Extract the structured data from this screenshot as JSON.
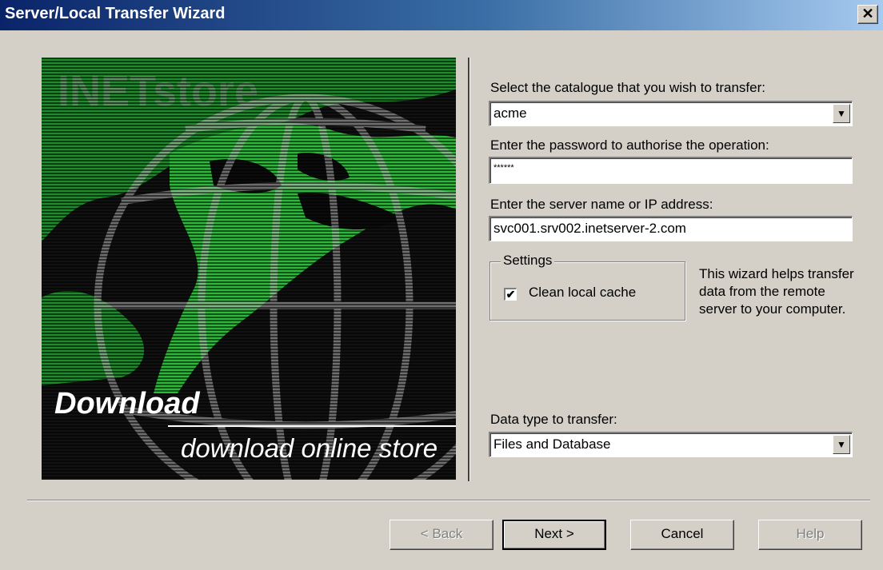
{
  "window": {
    "title": "Server/Local Transfer Wizard",
    "close_label": "✕"
  },
  "banner": {
    "title": "Download",
    "subtitle": "download online store",
    "logo_text": "INETstore"
  },
  "catalogue": {
    "label": "Select the catalogue that you wish to transfer:",
    "value": "acme"
  },
  "password": {
    "label": "Enter the password to authorise the operation:",
    "value": "******"
  },
  "server": {
    "label": "Enter the server name or IP address:",
    "value": "svc001.srv002.inetserver-2.com"
  },
  "settings": {
    "legend": "Settings",
    "clean_cache_label": "Clean local cache",
    "clean_cache_checked": true,
    "check_glyph": "✔"
  },
  "help_text": "This wizard helps transfer data from the remote server to your computer.",
  "data_type": {
    "label": "Data type to transfer:",
    "value": "Files and Database"
  },
  "dropdown_glyph": "▼",
  "buttons": {
    "back": "< Back",
    "next": "Next >",
    "cancel": "Cancel",
    "help": "Help"
  }
}
